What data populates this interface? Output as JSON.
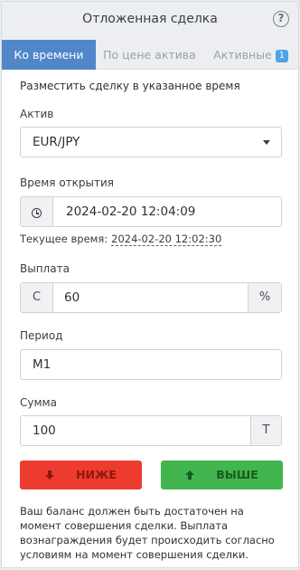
{
  "header": {
    "title": "Отложенная сделка",
    "help_icon": "?"
  },
  "tabs": [
    {
      "label": "Ко времени",
      "active": true
    },
    {
      "label": "По цене актива",
      "active": false
    },
    {
      "label": "Активные",
      "active": false,
      "badge": "1"
    }
  ],
  "form": {
    "subtitle": "Разместить сделку в указанное время",
    "asset": {
      "label": "Актив",
      "value": "EUR/JPY"
    },
    "open_time": {
      "label": "Время открытия",
      "value": "2024-02-20 12:04:09"
    },
    "current_time": {
      "label": "Текущее время:",
      "value": "2024-02-20 12:02:30"
    },
    "payout": {
      "label": "Выплата",
      "prefix": "C",
      "value": "60",
      "suffix": "%"
    },
    "period": {
      "label": "Период",
      "value": "M1"
    },
    "amount": {
      "label": "Сумма",
      "value": "100",
      "suffix": "T"
    }
  },
  "buttons": {
    "down_label": "НИЖЕ",
    "up_label": "ВЫШЕ"
  },
  "footnote": "Ваш баланс должен быть достаточен на момент совершения сделки. Выплата вознаграждения будет происходить согласно условиям на момент совершения сделки.",
  "colors": {
    "tab_active": "#5187c9",
    "badge": "#4fa3e6",
    "down_button": "#ee3b2f",
    "up_button": "#42b54f"
  }
}
